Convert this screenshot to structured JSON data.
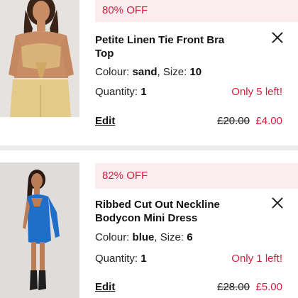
{
  "items": [
    {
      "discount": "80% OFF",
      "title": "Petite Linen Tie Front Bra Top",
      "colour_label": "Colour:",
      "colour": "sand",
      "size_label": "Size:",
      "size": "10",
      "quantity_label": "Quantity:",
      "quantity": "1",
      "stock": "Only 5 left!",
      "edit_label": "Edit",
      "price_old": "£20.00",
      "price_new": "£4.00",
      "image_icon": "product-photo-linen-top"
    },
    {
      "discount": "82% OFF",
      "title": "Ribbed Cut Out Neckline Bodycon Mini Dress",
      "colour_label": "Colour:",
      "colour": "blue",
      "size_label": "Size:",
      "size": "6",
      "quantity_label": "Quantity:",
      "quantity": "1",
      "stock": "Only 1 left!",
      "edit_label": "Edit",
      "price_old": "£28.00",
      "price_new": "£5.00",
      "image_icon": "product-photo-blue-dress"
    }
  ],
  "colors": {
    "accent_red": "#d41f3d",
    "badge_bg": "#fbecef",
    "divider": "#ececec"
  }
}
